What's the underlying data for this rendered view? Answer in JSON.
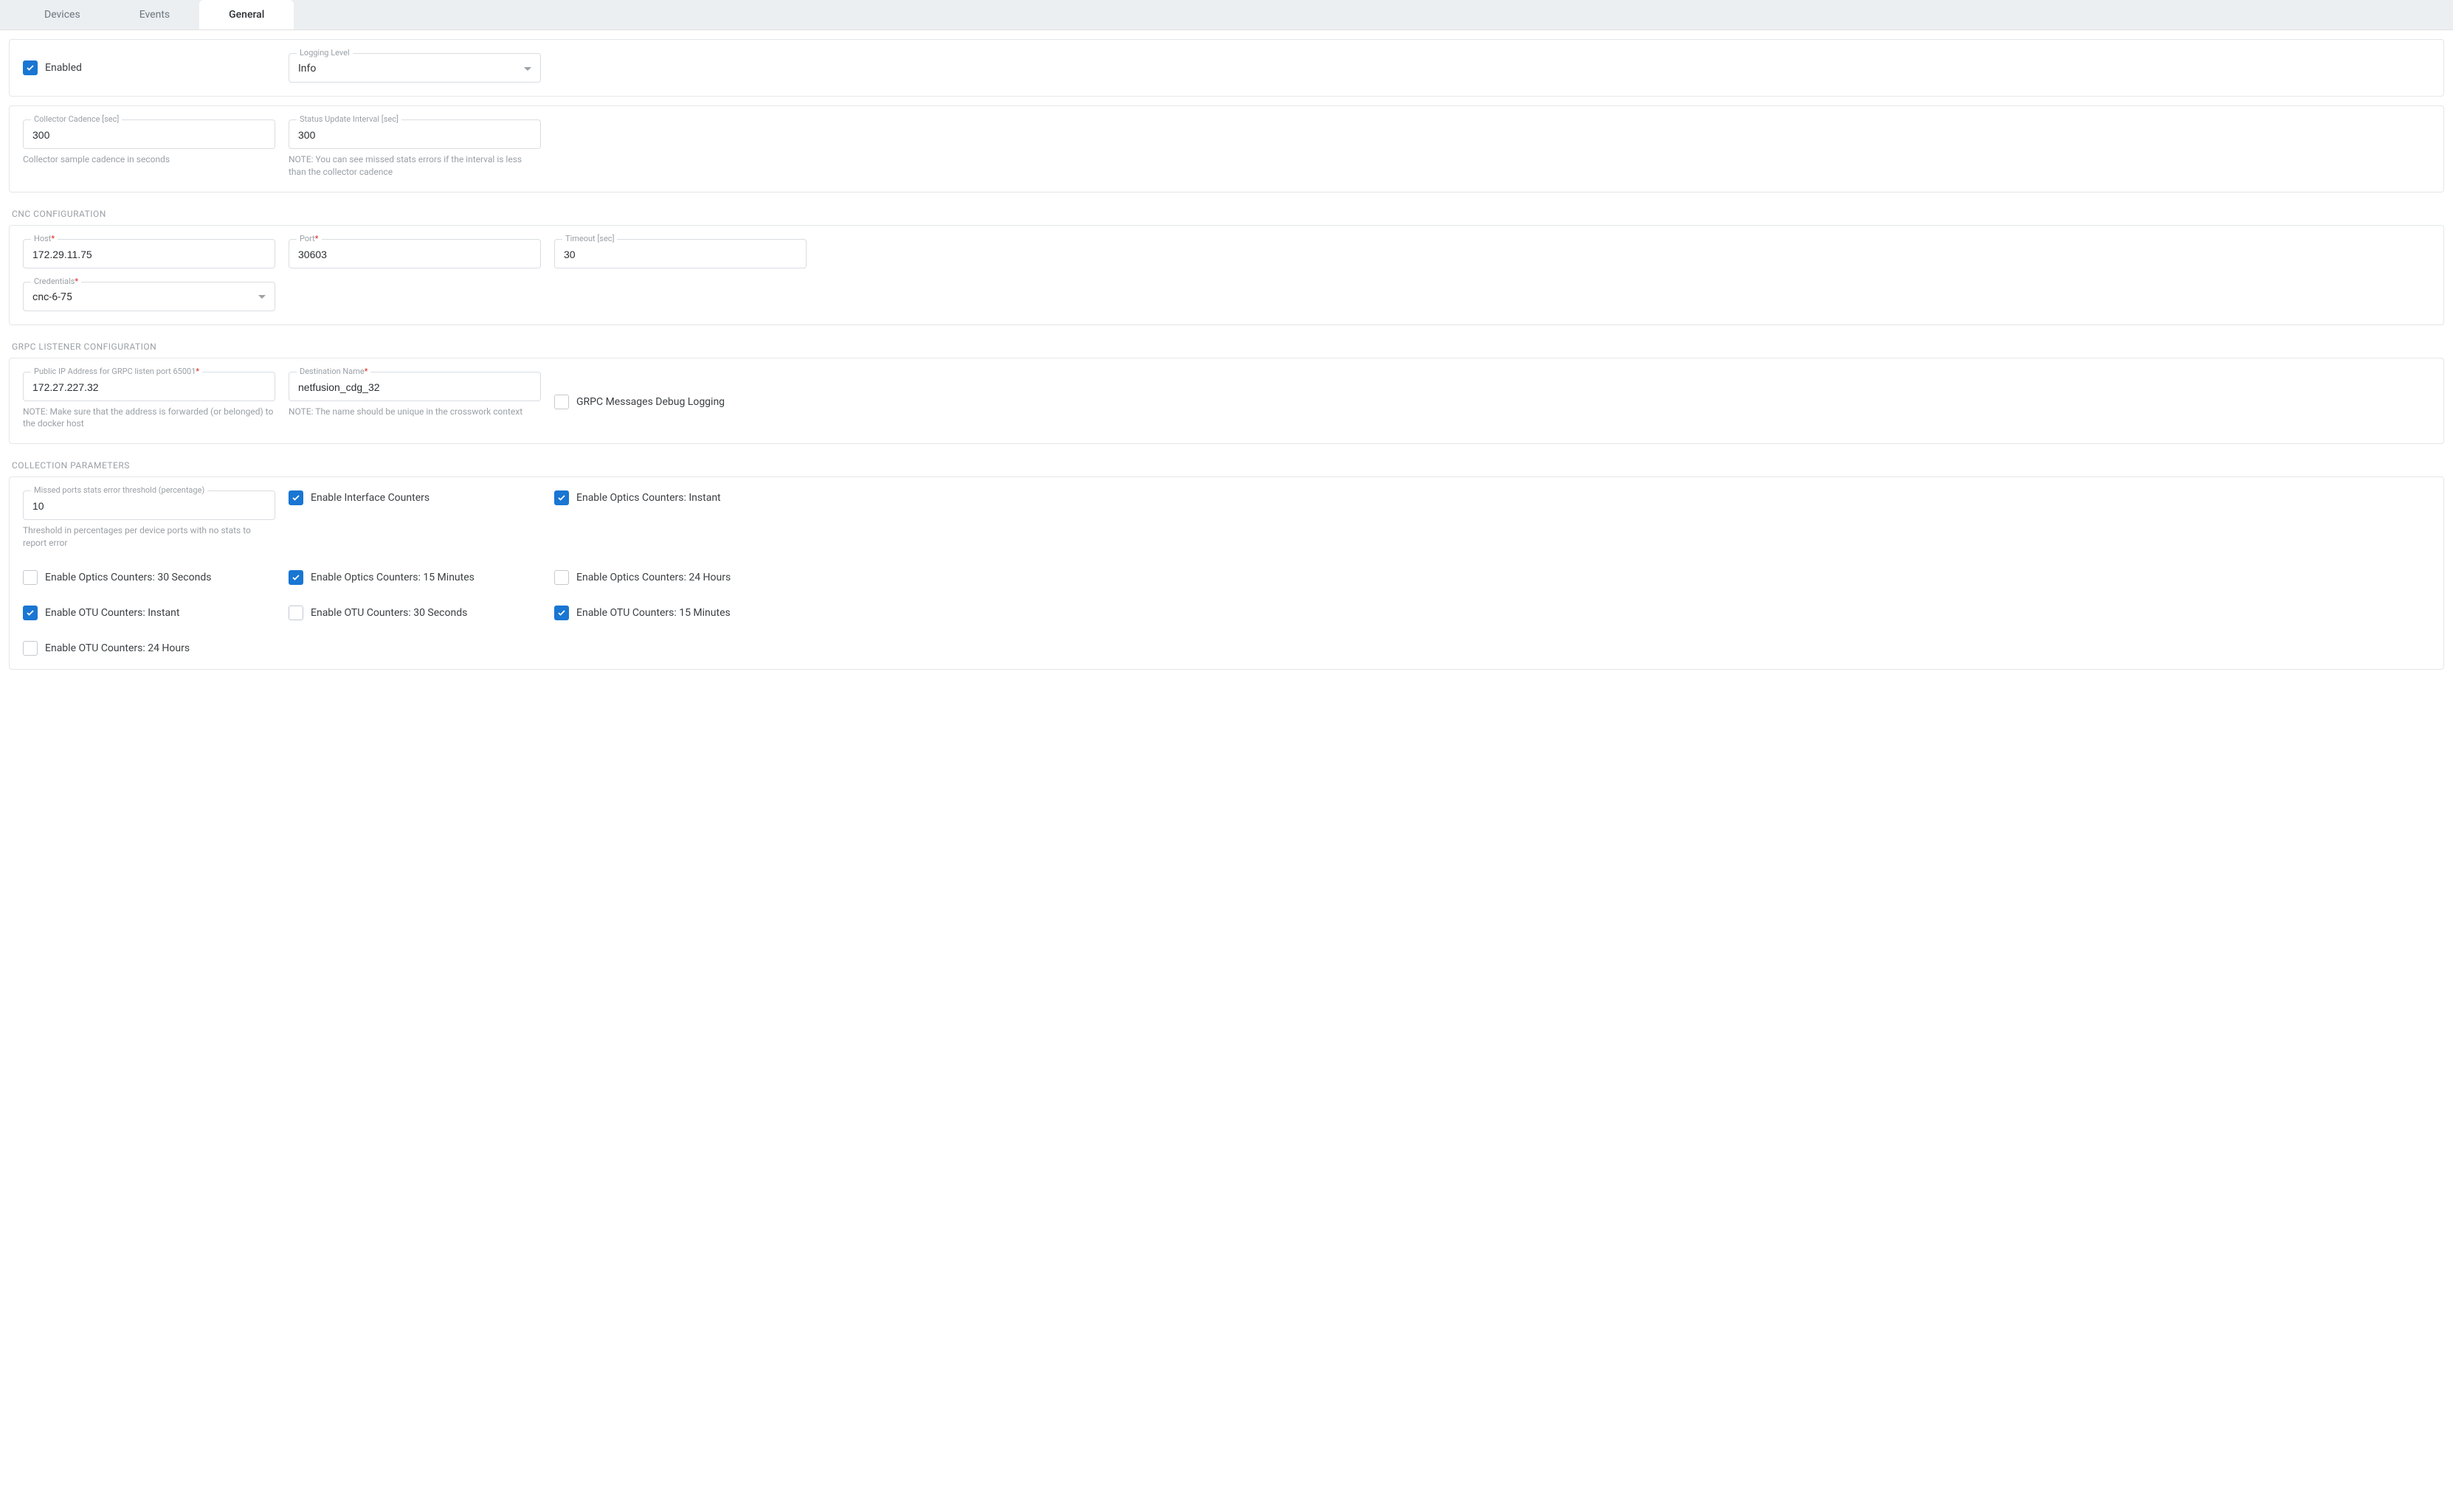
{
  "tabs": {
    "devices": "Devices",
    "events": "Events",
    "general": "General"
  },
  "panel1": {
    "enabled_label": "Enabled",
    "enabled_checked": true,
    "logging_level_label": "Logging Level",
    "logging_level_value": "Info"
  },
  "panel2": {
    "collector_cadence_label": "Collector Cadence [sec]",
    "collector_cadence_value": "300",
    "collector_cadence_helper": "Collector sample cadence in seconds",
    "status_interval_label": "Status Update Interval [sec]",
    "status_interval_value": "300",
    "status_interval_helper": "NOTE: You can see missed stats errors if the interval is less than the collector cadence"
  },
  "cnc": {
    "section_title": "CNC CONFIGURATION",
    "host_label": "Host",
    "host_value": "172.29.11.75",
    "port_label": "Port",
    "port_value": "30603",
    "timeout_label": "Timeout [sec]",
    "timeout_value": "30",
    "credentials_label": "Credentials",
    "credentials_value": "cnc-6-75"
  },
  "grpc": {
    "section_title": "GRPC LISTENER CONFIGURATION",
    "ip_label": "Public IP Address for GRPC listen port 65001",
    "ip_value": "172.27.227.32",
    "ip_helper": "NOTE: Make sure that the address is forwarded (or belonged) to the docker host",
    "dest_label": "Destination Name",
    "dest_value": "netfusion_cdg_32",
    "dest_helper": "NOTE: The name should be unique in the crosswork context",
    "debug_label": "GRPC Messages Debug Logging",
    "debug_checked": false
  },
  "collection": {
    "section_title": "COLLECTION PARAMETERS",
    "threshold_label": "Missed ports stats error threshold (percentage)",
    "threshold_value": "10",
    "threshold_helper": "Threshold in percentages per device ports with no stats to report error",
    "cb_interface": {
      "label": "Enable Interface Counters",
      "checked": true
    },
    "cb_optics_instant": {
      "label": "Enable Optics Counters: Instant",
      "checked": true
    },
    "cb_optics_30s": {
      "label": "Enable Optics Counters: 30 Seconds",
      "checked": false
    },
    "cb_optics_15m": {
      "label": "Enable Optics Counters: 15 Minutes",
      "checked": true
    },
    "cb_optics_24h": {
      "label": "Enable Optics Counters: 24 Hours",
      "checked": false
    },
    "cb_otu_instant": {
      "label": "Enable OTU Counters: Instant",
      "checked": true
    },
    "cb_otu_30s": {
      "label": "Enable OTU Counters: 30 Seconds",
      "checked": false
    },
    "cb_otu_15m": {
      "label": "Enable OTU Counters: 15 Minutes",
      "checked": true
    },
    "cb_otu_24h": {
      "label": "Enable OTU Counters: 24 Hours",
      "checked": false
    }
  }
}
